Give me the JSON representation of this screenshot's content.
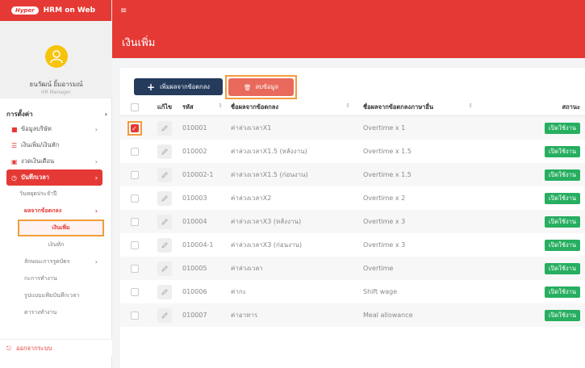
{
  "brand": {
    "logo": "Hyper",
    "name": "HRM on Web"
  },
  "user": {
    "name": "ธนวัฒน์ ยิ้มอารมณ์",
    "role": "HR Manager"
  },
  "menu": {
    "section": "การตั้งค่า",
    "items": [
      {
        "label": "ข้อมูลบริษัท",
        "icon": "briefcase-icon"
      },
      {
        "label": "เงินเพิ่ม/เงินหัก",
        "icon": "list-icon"
      },
      {
        "label": "งวดเงินเดือน",
        "icon": "money-icon"
      },
      {
        "label": "บันทึกเวลา",
        "icon": "clock-icon"
      }
    ],
    "sub": {
      "holiday": "วันหยุดประจำปี",
      "agreement": "ผลจากข้อตกลง",
      "income": "เงินเพิ่ม",
      "deduction": "เงินหัก",
      "card_type": "ลักษณะการรูดบัตร",
      "shift": "กะการทำงาน",
      "pattern": "รูปแบบแฟ้มบันทึกเวลา",
      "schedule": "ตารางทำงาน"
    },
    "logout": "ออกจากระบบ"
  },
  "page": {
    "title": "เงินเพิ่ม"
  },
  "toolbar": {
    "add_label": "เพิ่มผลจากข้อตกลง",
    "delete_label": "ลบข้อมูล"
  },
  "table": {
    "headers": {
      "edit": "แก้ไข",
      "code": "รหัส",
      "name": "ชื่อผลจากข้อตกลง",
      "other_name": "ชื่อผลจากข้อตกลงภาษาอื่น",
      "status": "สถานะ"
    },
    "rows": [
      {
        "checked": true,
        "code": "010001",
        "name": "ค่าล่วงเวลาX1",
        "other": "Overtime x 1",
        "status": "เปิดใช้งาน"
      },
      {
        "checked": false,
        "code": "010002",
        "name": "ค่าล่วงเวลาX1.5 (หลังงาน)",
        "other": "Overtime x 1.5",
        "status": "เปิดใช้งาน"
      },
      {
        "checked": false,
        "code": "010002-1",
        "name": "ค่าล่วงเวลาX1.5 (ก่อนงาน)",
        "other": "Overtime x 1.5",
        "status": "เปิดใช้งาน"
      },
      {
        "checked": false,
        "code": "010003",
        "name": "ค่าล่วงเวลาX2",
        "other": "Overtime x 2",
        "status": "เปิดใช้งาน"
      },
      {
        "checked": false,
        "code": "010004",
        "name": "ค่าล่วงเวลาX3 (หลังงาน)",
        "other": "Overtime x 3",
        "status": "เปิดใช้งาน"
      },
      {
        "checked": false,
        "code": "010004-1",
        "name": "ค่าล่วงเวลาX3 (ก่อนงาน)",
        "other": "Overtime x 3",
        "status": "เปิดใช้งาน"
      },
      {
        "checked": false,
        "code": "010005",
        "name": "ค่าล่วงเวลา",
        "other": "Overtime",
        "status": "เปิดใช้งาน"
      },
      {
        "checked": false,
        "code": "010006",
        "name": "ค่ากะ",
        "other": "Shift wage",
        "status": "เปิดใช้งาน"
      },
      {
        "checked": false,
        "code": "010007",
        "name": "ค่าอาหาร",
        "other": "Meal allowance",
        "status": "เปิดใช้งาน"
      }
    ]
  },
  "colors": {
    "primary": "#e53935",
    "navy": "#243b5c",
    "success": "#27ae60",
    "highlight": "#f39c3d"
  }
}
